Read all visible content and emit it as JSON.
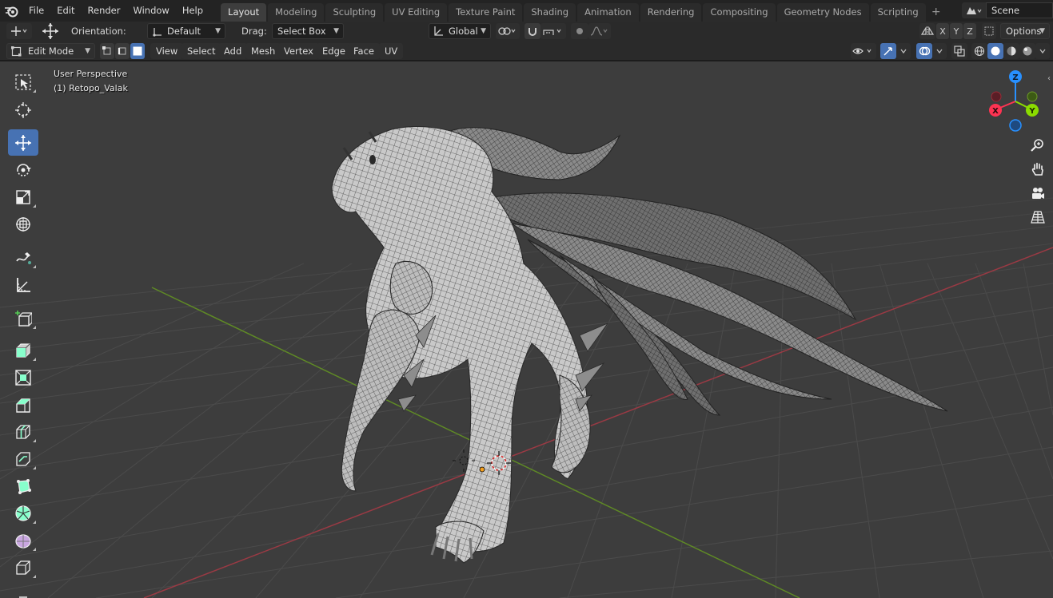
{
  "menubar": {
    "items": [
      "File",
      "Edit",
      "Render",
      "Window",
      "Help"
    ]
  },
  "workspaces": {
    "tabs": [
      "Layout",
      "Modeling",
      "Sculpting",
      "UV Editing",
      "Texture Paint",
      "Shading",
      "Animation",
      "Rendering",
      "Compositing",
      "Geometry Nodes",
      "Scripting"
    ],
    "active": "Layout",
    "add_label": "+"
  },
  "scene": {
    "name": "Scene"
  },
  "tool_header": {
    "orientation_label": "Orientation:",
    "orientation_value": "Default",
    "drag_label": "Drag:",
    "drag_value": "Select Box",
    "transform_orientation": "Global",
    "axis_x": "X",
    "axis_y": "Y",
    "axis_z": "Z",
    "options_label": "Options"
  },
  "editor_header": {
    "mode": "Edit Mode",
    "menus": [
      "View",
      "Select",
      "Add",
      "Mesh",
      "Vertex",
      "Edge",
      "Face",
      "UV"
    ]
  },
  "viewport": {
    "perspective_label": "User Perspective",
    "object_label": "(1) Retopo_Valak",
    "gizmo": {
      "z": "Z",
      "x": "X",
      "y": "Y"
    }
  },
  "toolbar": {
    "tools": [
      "select-box",
      "cursor",
      "move",
      "rotate",
      "scale",
      "transform",
      "annotate",
      "measure",
      "add-cube",
      "extrude",
      "inset",
      "bevel",
      "loop-cut",
      "knife",
      "poly-build",
      "spin",
      "smooth",
      "shrink-fatten",
      "shear"
    ],
    "active": "move"
  },
  "colors": {
    "accent": "#4772b3",
    "viewport_bg": "#3d3d3d",
    "axis_x": "#b8404a",
    "axis_y": "#6e9a2a",
    "gizmo_x": "#ff3352",
    "gizmo_y": "#8bdc00",
    "gizmo_z": "#2890ff"
  }
}
